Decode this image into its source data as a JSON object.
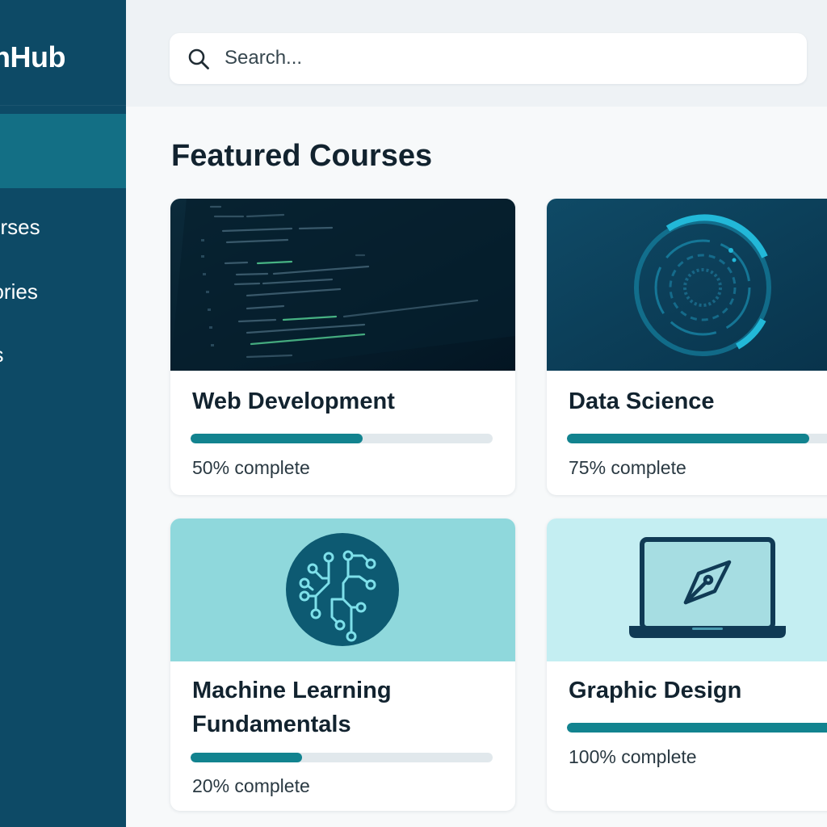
{
  "app": {
    "brand": "arnHub"
  },
  "sidebar": {
    "items": [
      {
        "label": "",
        "active": true
      },
      {
        "label": "urses"
      },
      {
        "label": "gories"
      },
      {
        "label": "ess"
      }
    ]
  },
  "search": {
    "placeholder": "Search...",
    "value": ""
  },
  "main": {
    "section_title": "Featured Courses",
    "courses": [
      {
        "title": "Web Development",
        "progress_label": "50% complete",
        "progress": 0.57,
        "image": "code-editor-image"
      },
      {
        "title": "Data Science",
        "progress_label": "75% complete",
        "progress": 0.75,
        "image": "data-ring-image"
      },
      {
        "title": "Machine Learning Fundamentals",
        "progress_label": "20% complete",
        "progress": 0.37,
        "image": "neural-brain-image"
      },
      {
        "title": "Graphic Design",
        "progress_label": "100% complete",
        "progress": 1.0,
        "image": "laptop-pen-image"
      }
    ]
  },
  "colors": {
    "sidebar": "#0d4a66",
    "sidebar_active": "#136f85",
    "accent": "#12838f",
    "progress_track": "#e1e8ec",
    "ml_thumb": "#8fd8dc",
    "gd_thumb": "#c4eef2"
  }
}
